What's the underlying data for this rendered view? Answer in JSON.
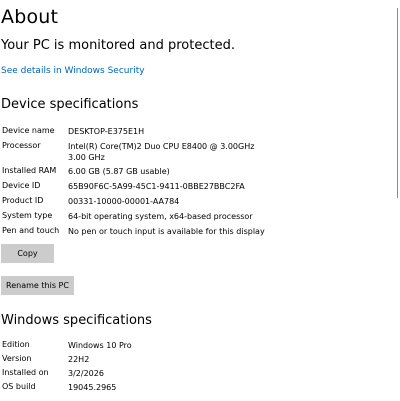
{
  "header": {
    "title": "About",
    "protection_status": "Your PC is monitored and protected.",
    "security_link": "See details in Windows Security"
  },
  "device_specifications": {
    "title": "Device specifications",
    "rows": [
      {
        "label": "Device name",
        "value": "DESKTOP-E375E1H"
      },
      {
        "label": "Processor",
        "value": "Intel(R) Core(TM)2 Duo CPU     E8400  @ 3.00GHz",
        "value2": "3.00 GHz"
      },
      {
        "label": "Installed RAM",
        "value": "6.00 GB (5.87 GB usable)"
      },
      {
        "label": "Device ID",
        "value": "65B90F6C-5A99-45C1-9411-0BBE27BBC2FA"
      },
      {
        "label": "Product ID",
        "value": "00331-10000-00001-AA784"
      },
      {
        "label": "System type",
        "value": "64-bit operating system, x64-based processor"
      },
      {
        "label": "Pen and touch",
        "value": "No pen or touch input is available for this display"
      }
    ],
    "copy_button": "Copy",
    "rename_button": "Rename this PC"
  },
  "windows_specifications": {
    "title": "Windows specifications",
    "rows": [
      {
        "label": "Edition",
        "value": "Windows 10 Pro"
      },
      {
        "label": "Version",
        "value": "22H2"
      },
      {
        "label": "Installed on",
        "value": "3/2/2026"
      },
      {
        "label": "OS build",
        "value": "19045.2965"
      }
    ]
  }
}
